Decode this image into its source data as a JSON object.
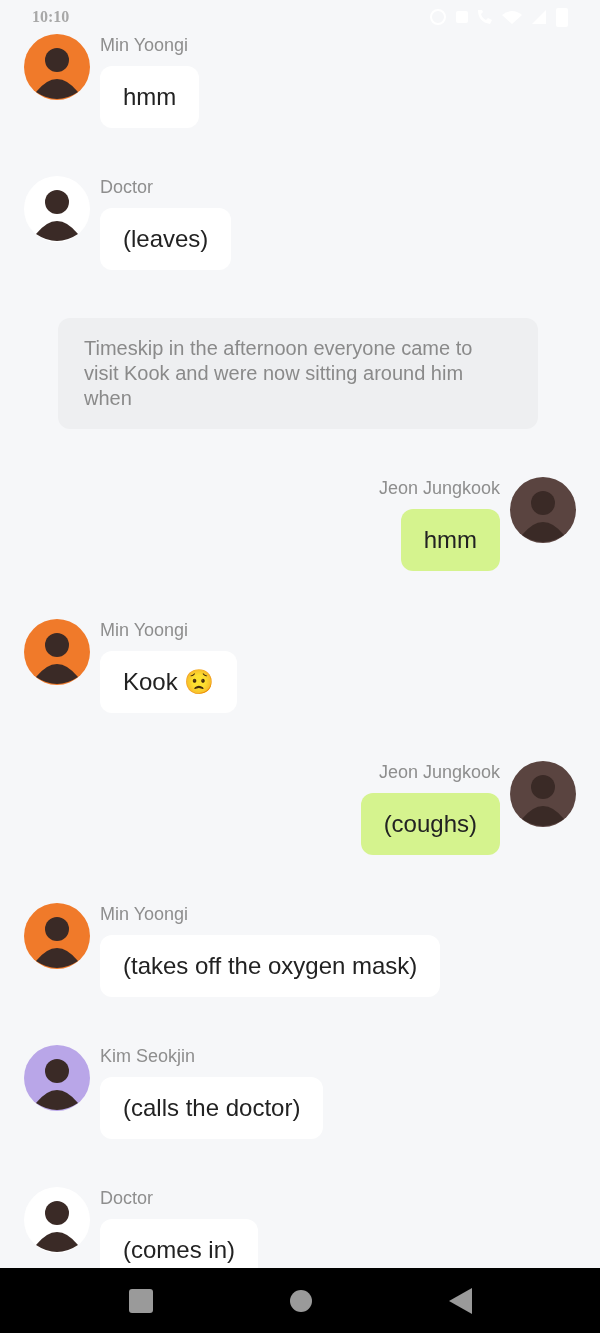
{
  "status_bar": {
    "time": "10:10"
  },
  "messages": [
    {
      "kind": "received",
      "sender": "Min Yoongi",
      "color": "#f07a2a",
      "text": "hmm"
    },
    {
      "kind": "received",
      "sender": "Doctor",
      "color": "#ffffff",
      "text": "(leaves)"
    },
    {
      "kind": "narration",
      "text": "Timeskip in the afternoon everyone came to visit Kook and were now sitting around him when"
    },
    {
      "kind": "sent",
      "sender": "Jeon Jungkook",
      "color": "#5a4440",
      "text": "hmm"
    },
    {
      "kind": "received",
      "sender": "Min Yoongi",
      "color": "#f07a2a",
      "text": "Kook 😟"
    },
    {
      "kind": "sent",
      "sender": "Jeon Jungkook",
      "color": "#5a4440",
      "text": "(coughs)"
    },
    {
      "kind": "received",
      "sender": "Min Yoongi",
      "color": "#f07a2a",
      "text": "(takes off the oxygen mask)"
    },
    {
      "kind": "received",
      "sender": "Kim Seokjin",
      "color": "#b9a6e8",
      "text": "(calls the doctor)"
    },
    {
      "kind": "received",
      "sender": "Doctor",
      "color": "#ffffff",
      "text": "(comes in)"
    }
  ]
}
